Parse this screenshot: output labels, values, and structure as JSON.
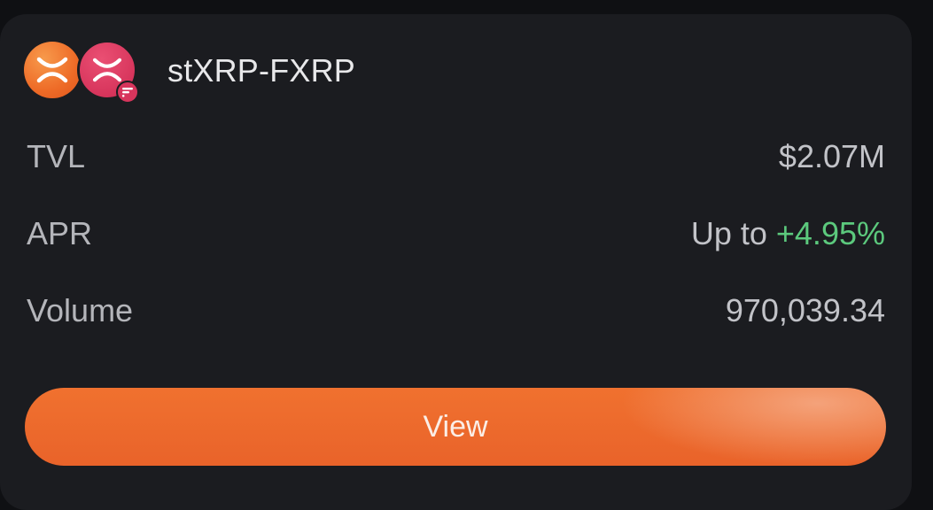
{
  "pool": {
    "name": "stXRP-FXRP",
    "token_a_icon": "xrp-icon",
    "token_b_icon": "xrp-icon",
    "badge_icon": "flare-icon"
  },
  "stats": {
    "tvl_label": "TVL",
    "tvl_value": "$2.07M",
    "apr_label": "APR",
    "apr_prefix": "Up to",
    "apr_value": "+4.95%",
    "volume_label": "Volume",
    "volume_value": "970,039.34"
  },
  "actions": {
    "view_label": "View"
  },
  "colors": {
    "card_bg": "#1b1c20",
    "accent": "#ec6a2c",
    "positive": "#5cc97d",
    "token_a": "#ee6b27",
    "token_b": "#d7355c"
  }
}
